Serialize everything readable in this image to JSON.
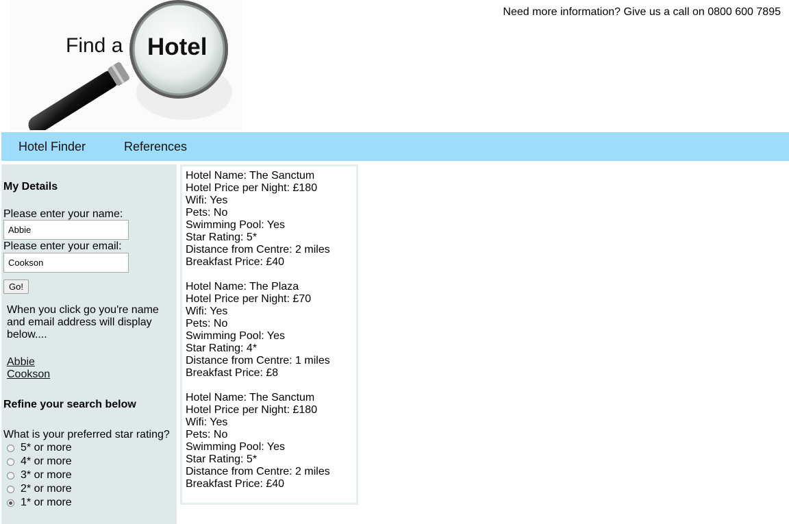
{
  "header": {
    "logo_text_find": "Find a",
    "logo_text_hotel": "Hotel",
    "contact": "Need more information? Give us a call on 0800 600 7895"
  },
  "nav": {
    "items": [
      "Hotel Finder",
      "References"
    ]
  },
  "sidebar": {
    "details_heading": "My Details",
    "name_label": "Please enter your name:",
    "name_value": "Abbie",
    "email_label": "Please enter your email:",
    "email_value": "Cookson",
    "go_label": "Go!",
    "info_text": "When you click go you're name and email address will display below....",
    "display_name": "Abbie",
    "display_email": "Cookson",
    "refine_heading": "Refine your search below",
    "star_question": "What is your preferred star rating?",
    "star_options": [
      "5* or more",
      "4* or more",
      "3* or more",
      "2* or more",
      "1* or more"
    ],
    "selected_option": "1* or more"
  },
  "results": [
    {
      "name": "Hotel Name: The Sanctum",
      "price": "Hotel Price per Night: £180",
      "wifi": "Wifi: Yes",
      "pets": "Pets: No",
      "pool": "Swimming Pool: Yes",
      "stars": "Star Rating: 5*",
      "distance": "Distance from Centre: 2 miles",
      "breakfast": "Breakfast Price: £40"
    },
    {
      "name": "Hotel Name: The Plaza",
      "price": "Hotel Price per Night: £70",
      "wifi": "Wifi: Yes",
      "pets": "Pets: No",
      "pool": "Swimming Pool: Yes",
      "stars": "Star Rating: 4*",
      "distance": "Distance from Centre: 1 miles",
      "breakfast": "Breakfast Price: £8"
    },
    {
      "name": "Hotel Name: The Sanctum",
      "price": "Hotel Price per Night: £180",
      "wifi": "Wifi: Yes",
      "pets": "Pets: No",
      "pool": "Swimming Pool: Yes",
      "stars": "Star Rating: 5*",
      "distance": "Distance from Centre: 2 miles",
      "breakfast": "Breakfast Price: £40"
    }
  ]
}
